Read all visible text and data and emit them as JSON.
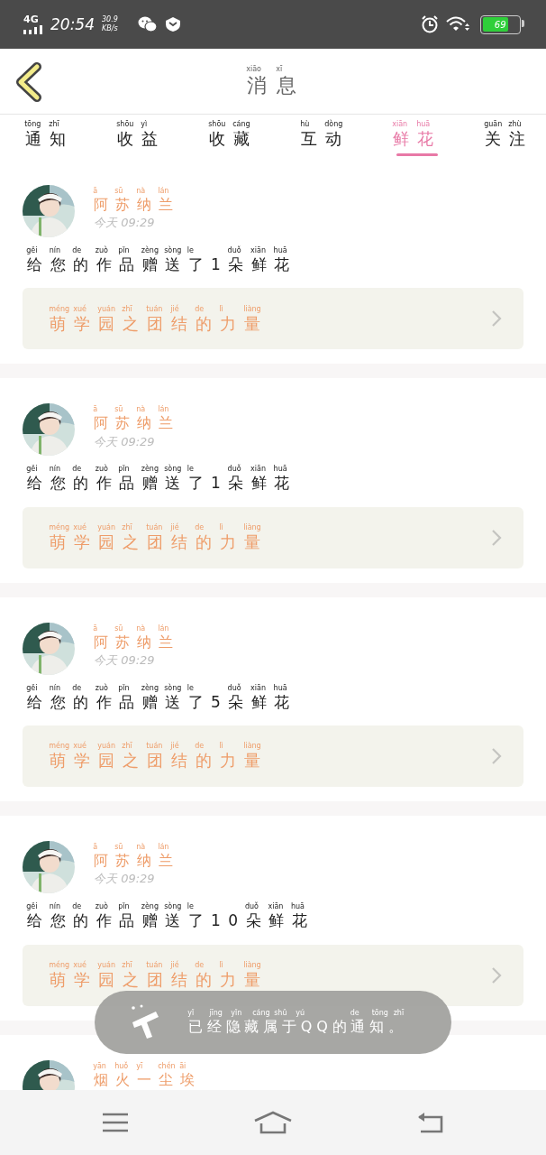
{
  "status_bar": {
    "network": "4G",
    "time": "20:54",
    "speed": "30.9",
    "speed_unit": "KB/s",
    "battery": "69"
  },
  "header": {
    "title": {
      "text": "消息",
      "pinyin": "xiāo xī"
    }
  },
  "tabs": [
    {
      "label": "通知",
      "pinyin": "tōng zhī",
      "selected": false
    },
    {
      "label": "收益",
      "pinyin": "shōu yì",
      "selected": false
    },
    {
      "label": "收藏",
      "pinyin": "shōu cáng",
      "selected": false
    },
    {
      "label": "互动",
      "pinyin": "hù dòng",
      "selected": false
    },
    {
      "label": "鲜花",
      "pinyin": "xiān huā",
      "selected": true
    },
    {
      "label": "关注",
      "pinyin": "guān zhù",
      "selected": false
    }
  ],
  "notifications": [
    {
      "sender": {
        "text": "阿苏纳兰",
        "pinyin": "ā sū nà lán"
      },
      "time": "今天 09:29",
      "message": {
        "text": "给您的作品赠送了1朵鲜花",
        "pinyin": "gěi nín de zuò pǐn zèng sòng le duǒ xiān huā"
      },
      "work": {
        "text": "萌学园之团结的力量",
        "pinyin": "méng xué yuán zhī tuán jié de lì liàng"
      }
    },
    {
      "sender": {
        "text": "阿苏纳兰",
        "pinyin": "ā sū nà lán"
      },
      "time": "今天 09:29",
      "message": {
        "text": "给您的作品赠送了1朵鲜花",
        "pinyin": "gěi nín de zuò pǐn zèng sòng le duǒ xiān huā"
      },
      "work": {
        "text": "萌学园之团结的力量",
        "pinyin": "méng xué yuán zhī tuán jié de lì liàng"
      }
    },
    {
      "sender": {
        "text": "阿苏纳兰",
        "pinyin": "ā sū nà lán"
      },
      "time": "今天 09:29",
      "message": {
        "text": "给您的作品赠送了5朵鲜花",
        "pinyin": "gěi nín de zuò pǐn zèng sòng le duǒ xiān huā"
      },
      "work": {
        "text": "萌学园之团结的力量",
        "pinyin": "méng xué yuán zhī tuán jié de lì liàng"
      }
    },
    {
      "sender": {
        "text": "阿苏纳兰",
        "pinyin": "ā sū nà lán"
      },
      "time": "今天 09:29",
      "message": {
        "text": "给您的作品赠送了10朵鲜花",
        "pinyin": "gěi nín de zuò pǐn zèng sòng le duǒ xiān huā"
      },
      "work": {
        "text": "萌学园之团结的力量",
        "pinyin": "méng xué yuán zhī tuán jié de lì liàng"
      }
    },
    {
      "sender": {
        "text": "烟火一尘埃",
        "pinyin": "yān huǒ yī chén āi"
      }
    }
  ],
  "toast": {
    "text": "已经隐藏属于QQ的通知。",
    "pinyin": "yǐ jīng yǐn cáng shǔ yú de tōng zhī"
  }
}
